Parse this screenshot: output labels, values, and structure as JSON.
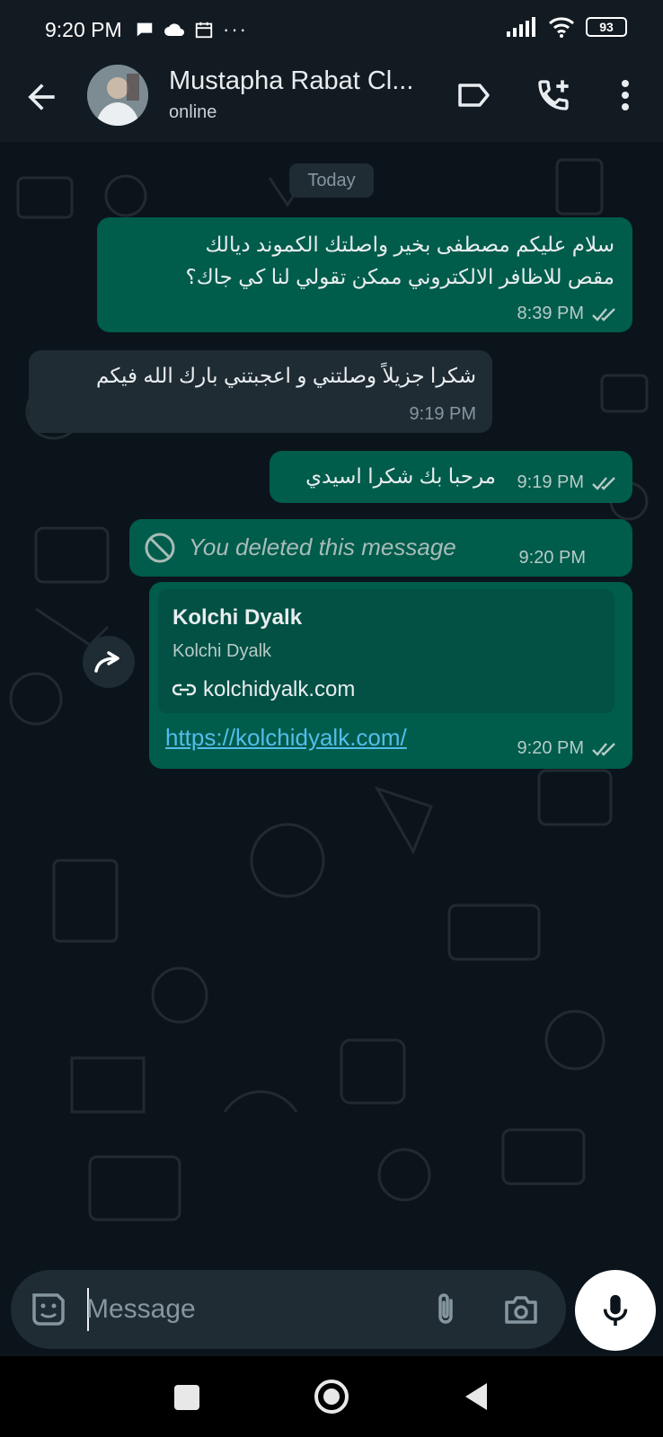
{
  "status_bar": {
    "time": "9:20 PM",
    "battery": "93"
  },
  "header": {
    "contact_name": "Mustapha Rabat Cl...",
    "contact_status": "online"
  },
  "chat": {
    "date_label": "Today",
    "messages": [
      {
        "line1": "سلام عليكم مصطفى بخير واصلتك الكموند ديالك",
        "line2": "مقص للاظافر الالكتروني ممكن تقولي لنا كي جاك؟",
        "time": "8:39 PM"
      },
      {
        "text": "شكرا جزيلاً وصلتني و اعجبتني بارك الله فيكم",
        "time": "9:19 PM"
      },
      {
        "text": "مرحبا بك شكرا اسيدي",
        "time": "9:19 PM"
      },
      {
        "text": "You deleted this message",
        "time": "9:20 PM"
      },
      {
        "card_title": "Kolchi Dyalk",
        "card_subtitle": "Kolchi Dyalk",
        "card_domain": "kolchidyalk.com",
        "url": "https://kolchidyalk.com/",
        "time": "9:20 PM"
      }
    ]
  },
  "composer": {
    "placeholder": "Message"
  },
  "colors": {
    "background": "#0b141a",
    "outgoing_bubble": "#005c4b",
    "incoming_bubble": "#202c33",
    "link": "#53bdeb",
    "read_ticks": "#b7cbc7"
  }
}
